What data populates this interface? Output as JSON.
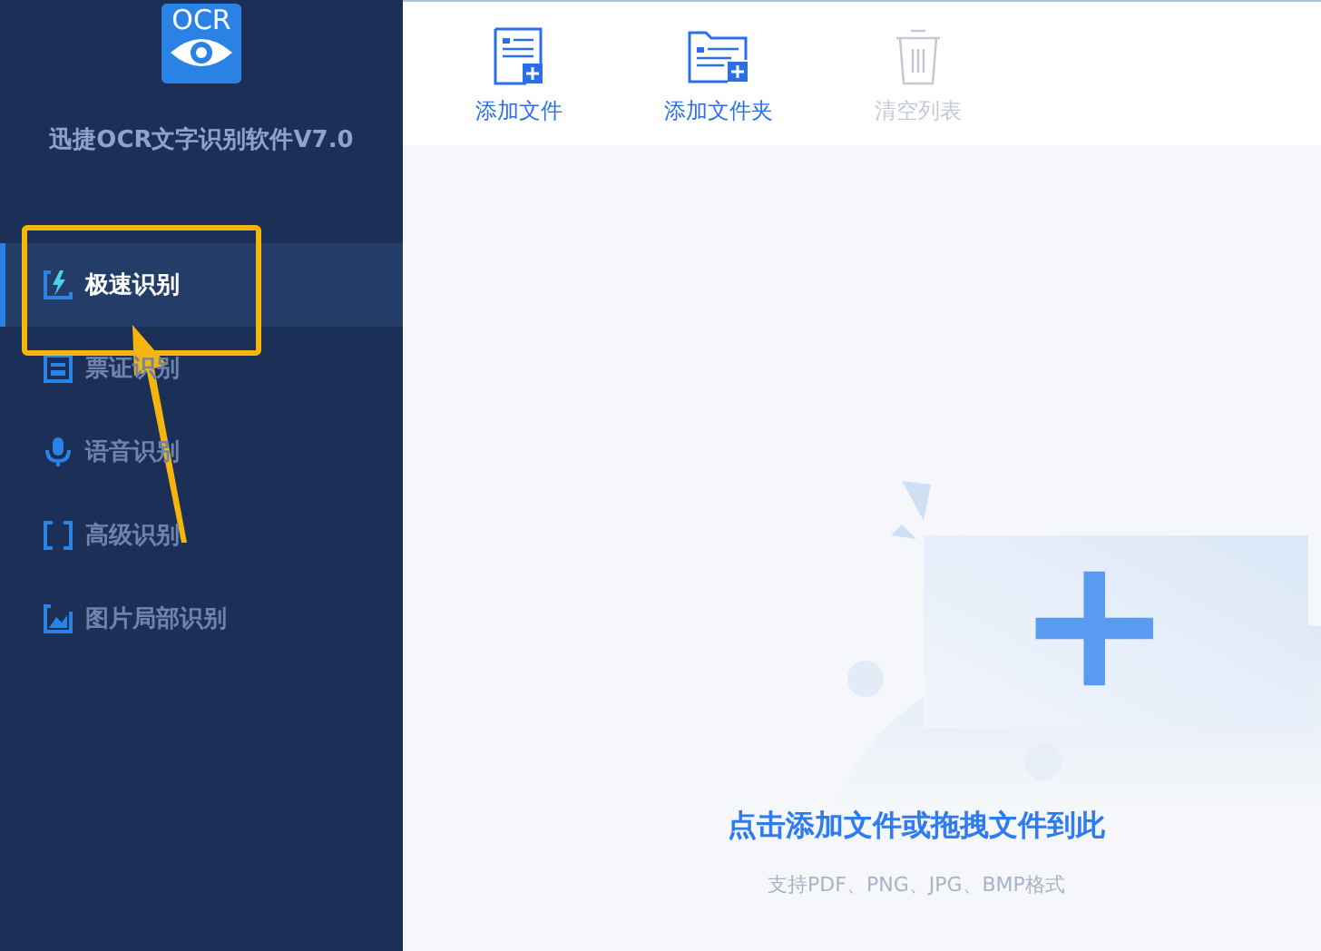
{
  "app": {
    "logo_text": "OCR",
    "title": "迅捷OCR文字识别软件V7.0"
  },
  "sidebar": {
    "items": [
      {
        "label": "极速识别",
        "kind": "fast",
        "selected": true
      },
      {
        "label": "票证识别",
        "kind": "card",
        "selected": false
      },
      {
        "label": "语音识别",
        "kind": "voice",
        "selected": false
      },
      {
        "label": "高级识别",
        "kind": "advanced",
        "selected": false
      },
      {
        "label": "图片局部识别",
        "kind": "image",
        "selected": false
      }
    ]
  },
  "toolbar": [
    {
      "label": "添加文件",
      "kind": "file",
      "disabled": false
    },
    {
      "label": "添加文件夹",
      "kind": "folder",
      "disabled": false
    },
    {
      "label": "清空列表",
      "kind": "trash",
      "disabled": true
    }
  ],
  "dropzone": {
    "heading": "点击添加文件或拖拽文件到此",
    "hint": "支持PDF、PNG、JPG、BMP格式"
  }
}
